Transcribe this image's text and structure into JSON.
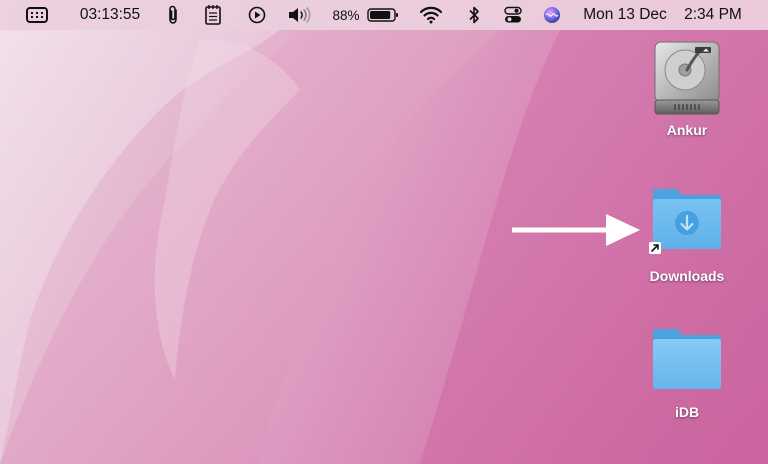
{
  "menubar": {
    "timer": "03:13:55",
    "battery_percent": "88%",
    "battery_level": 0.88,
    "date": "Mon 13 Dec",
    "time": "2:34 PM"
  },
  "desktop": {
    "items": [
      {
        "label": "Ankur",
        "kind": "hard-drive-icon"
      },
      {
        "label": "Downloads",
        "kind": "downloads-folder-alias-icon"
      },
      {
        "label": "iDB",
        "kind": "folder-icon"
      }
    ]
  },
  "annotation": {
    "arrow_color": "#ffffff"
  },
  "colors": {
    "wallpaper_light": "#eed9e6",
    "wallpaper_dark": "#cc6aa3",
    "folder_blue": "#6cbcef",
    "menubar": "#ecd0de"
  }
}
